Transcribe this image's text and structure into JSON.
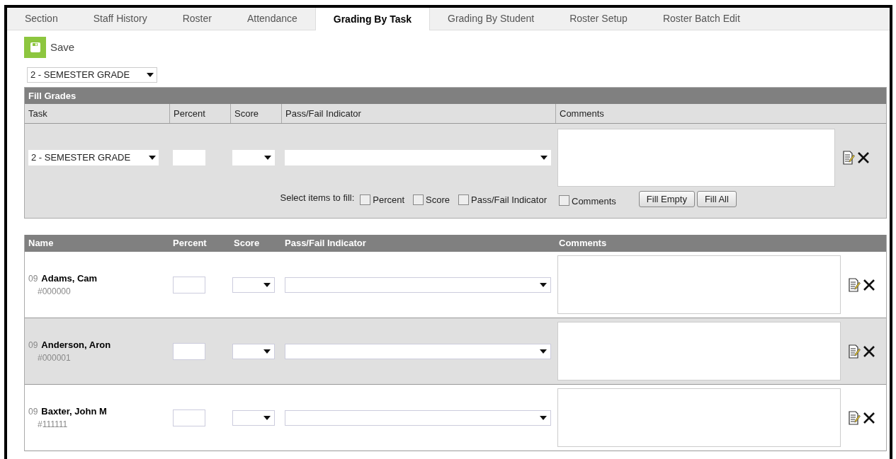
{
  "tabs": [
    {
      "label": "Section",
      "selected": false
    },
    {
      "label": "Staff History",
      "selected": false
    },
    {
      "label": "Roster",
      "selected": false
    },
    {
      "label": "Attendance",
      "selected": false
    },
    {
      "label": "Grading By Task",
      "selected": true
    },
    {
      "label": "Grading By Student",
      "selected": false
    },
    {
      "label": "Roster Setup",
      "selected": false
    },
    {
      "label": "Roster Batch Edit",
      "selected": false
    }
  ],
  "toolbar": {
    "save_label": "Save"
  },
  "term_select": {
    "value": "2 - SEMESTER GRADE"
  },
  "fill_grades": {
    "title": "Fill Grades",
    "columns": [
      "Task",
      "Percent",
      "Score",
      "Pass/Fail Indicator",
      "Comments"
    ],
    "task_select": "2 - SEMESTER GRADE",
    "select_label": "Select items to fill:",
    "fill_options": [
      {
        "label": "Percent",
        "checked": false
      },
      {
        "label": "Score",
        "checked": false
      },
      {
        "label": "Pass/Fail Indicator",
        "checked": false
      },
      {
        "label": "Comments",
        "checked": false
      }
    ],
    "buttons": [
      "Fill Empty",
      "Fill All"
    ]
  },
  "roster": {
    "columns": [
      "Name",
      "Percent",
      "Score",
      "Pass/Fail Indicator",
      "Comments"
    ],
    "rows": [
      {
        "grade": "09",
        "name": "Adams, Cam",
        "student_number": "#000000"
      },
      {
        "grade": "09",
        "name": "Anderson, Aron",
        "student_number": "#000001"
      },
      {
        "grade": "09",
        "name": "Baxter, John M",
        "student_number": "#111111"
      }
    ]
  }
}
